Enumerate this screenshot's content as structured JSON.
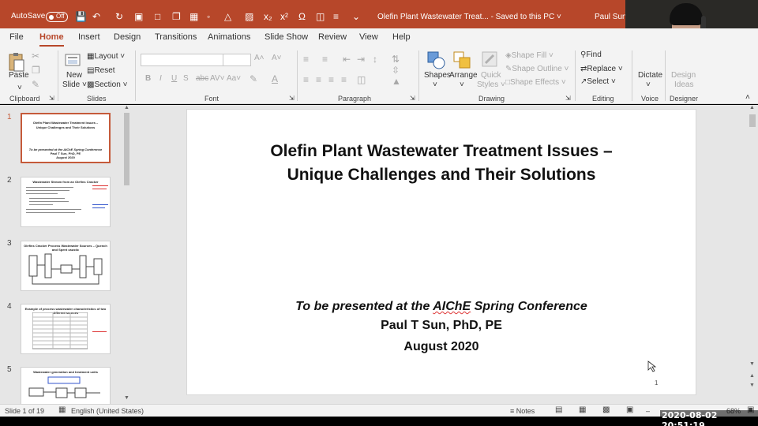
{
  "titlebar": {
    "autosave_label": "AutoSave",
    "autosave_state": "Off",
    "document_title": "Olefin Plant Wastewater Treat...  -  Saved to this PC ˅",
    "user_name": "Paul Sun",
    "accent_color": "#b7472a"
  },
  "tabs": [
    "File",
    "Home",
    "Insert",
    "Design",
    "Transitions",
    "Animations",
    "Slide Show",
    "Review",
    "View",
    "Help"
  ],
  "active_tab": "Home",
  "ribbon": {
    "clipboard": {
      "label": "Clipboard",
      "paste": "Paste"
    },
    "slides": {
      "label": "Slides",
      "new_slide_1": "New",
      "new_slide_2": "Slide ˅",
      "layout": "Layout ˅",
      "reset": "Reset",
      "section": "Section ˅"
    },
    "font": {
      "label": "Font",
      "bold": "B",
      "italic": "I",
      "underline": "U",
      "strike": "S",
      "spacing": "AV˅",
      "case": "Aa˅"
    },
    "paragraph": {
      "label": "Paragraph"
    },
    "drawing": {
      "label": "Drawing",
      "shapes": "Shapes",
      "arrange": "Arrange",
      "quick_styles_1": "Quick",
      "quick_styles_2": "Styles ˅",
      "shape_fill": "Shape Fill ˅",
      "shape_outline": "Shape Outline ˅",
      "shape_effects": "Shape Effects ˅"
    },
    "editing": {
      "label": "Editing",
      "find": "Find",
      "replace": "Replace ˅",
      "select": "Select ˅"
    },
    "voice": {
      "label": "Voice",
      "dictate": "Dictate"
    },
    "designer": {
      "label": "Designer",
      "design_ideas_1": "Design",
      "design_ideas_2": "Ideas"
    }
  },
  "thumbnails": [
    {
      "number": "1",
      "title_1": "Olefin Plant Wastewater Treatment Issues –",
      "title_2": "Unique Challenges and Their Solutions",
      "line_1": "To be presented at the AIChE Spring Conference",
      "line_2": "Paul T Sun, PhD, PE",
      "line_3": "August 2020"
    },
    {
      "number": "2",
      "title": "Wastewater Stream from an Olefins Cracker"
    },
    {
      "number": "3",
      "title": "Olefins Cracker Process Wastewater Sources – Quench and Spent caustic"
    },
    {
      "number": "4",
      "title": "Example of process wastewater characteristics of two different sources"
    },
    {
      "number": "5",
      "title": "Wastewater generation and treatment units"
    }
  ],
  "slide": {
    "title_line_1": "Olefin Plant Wastewater Treatment Issues –",
    "title_line_2": "Unique Challenges and Their Solutions",
    "presented_prefix": "To be presented at the ",
    "presented_misspelled": "AIChE",
    "presented_suffix": " Spring Conference",
    "author": "Paul T Sun, PhD, PE",
    "date": "August 2020",
    "page_number": "1"
  },
  "statusbar": {
    "slide_counter": "Slide 1 of 19",
    "language": "English (United States)",
    "notes": "Notes",
    "zoom": "68%"
  },
  "overlay_timestamp": "2020-08-02  20:51:19"
}
